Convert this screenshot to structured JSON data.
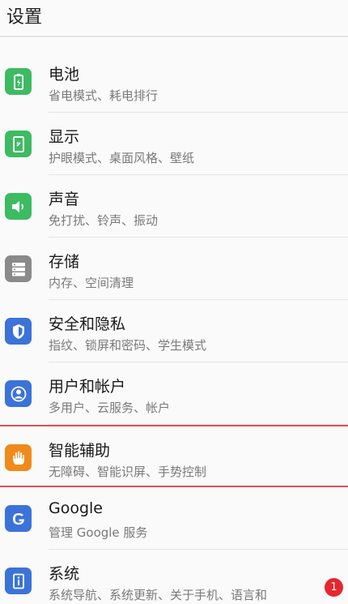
{
  "header": {
    "title": "设置"
  },
  "items": [
    {
      "key": "battery",
      "title": "电池",
      "subtitle": "省电模式、耗电排行",
      "icon": "battery-icon",
      "color": "#3dbb62"
    },
    {
      "key": "display",
      "title": "显示",
      "subtitle": "护眼模式、桌面风格、壁纸",
      "icon": "display-icon",
      "color": "#3dbb62"
    },
    {
      "key": "sound",
      "title": "声音",
      "subtitle": "免打扰、铃声、振动",
      "icon": "speaker-icon",
      "color": "#3dbb62"
    },
    {
      "key": "storage",
      "title": "存储",
      "subtitle": "内存、空间清理",
      "icon": "storage-icon",
      "color": "#8a8a8a"
    },
    {
      "key": "security",
      "title": "安全和隐私",
      "subtitle": "指纹、锁屏和密码、学生模式",
      "icon": "shield-icon",
      "color": "#3b73d9"
    },
    {
      "key": "users",
      "title": "用户和帐户",
      "subtitle": "多用户、云服务、帐户",
      "icon": "user-icon",
      "color": "#3b73d9"
    },
    {
      "key": "accessibility",
      "title": "智能辅助",
      "subtitle": "无障碍、智能识屏、手势控制",
      "icon": "hand-icon",
      "color": "#f08a1c"
    },
    {
      "key": "google",
      "title": "Google",
      "subtitle": "管理 Google 服务",
      "icon": "google-icon",
      "color": "#3b73d9"
    },
    {
      "key": "system",
      "title": "系统",
      "subtitle": "系统导航、系统更新、关于手机、语言和",
      "icon": "system-info-icon",
      "color": "#3b73d9",
      "badge": "1"
    }
  ],
  "colors": {
    "highlight_border": "#e0505a",
    "badge": "#e8262e"
  }
}
